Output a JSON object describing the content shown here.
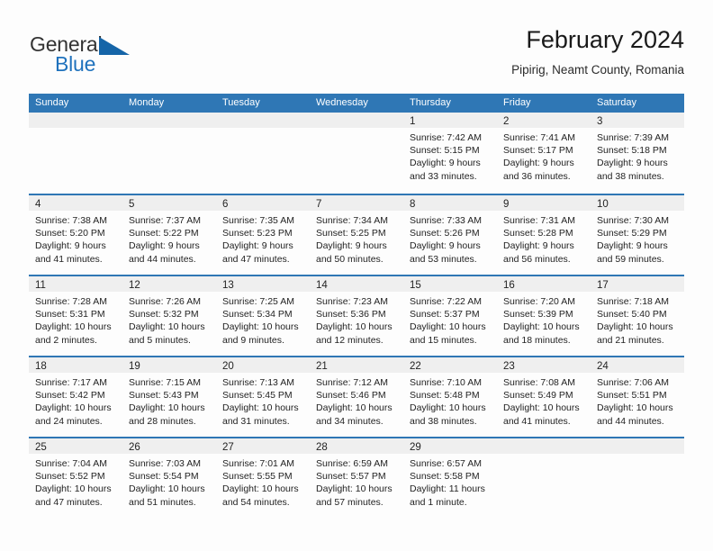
{
  "brand": {
    "word_one": "General",
    "word_two": "Blue",
    "icon": "triangle-logo",
    "accent_color": "#1f72bd"
  },
  "header": {
    "title": "February 2024",
    "subtitle": "Pipirig, Neamt County, Romania"
  },
  "theme": {
    "header_blue": "#2f77b5",
    "day_band_gray": "#efefef",
    "text": "#232323"
  },
  "weekdays": [
    "Sunday",
    "Monday",
    "Tuesday",
    "Wednesday",
    "Thursday",
    "Friday",
    "Saturday"
  ],
  "weeks": [
    [
      {
        "day": "",
        "lines": []
      },
      {
        "day": "",
        "lines": []
      },
      {
        "day": "",
        "lines": []
      },
      {
        "day": "",
        "lines": []
      },
      {
        "day": "1",
        "lines": [
          "Sunrise: 7:42 AM",
          "Sunset: 5:15 PM",
          "Daylight: 9 hours",
          "and 33 minutes."
        ]
      },
      {
        "day": "2",
        "lines": [
          "Sunrise: 7:41 AM",
          "Sunset: 5:17 PM",
          "Daylight: 9 hours",
          "and 36 minutes."
        ]
      },
      {
        "day": "3",
        "lines": [
          "Sunrise: 7:39 AM",
          "Sunset: 5:18 PM",
          "Daylight: 9 hours",
          "and 38 minutes."
        ]
      }
    ],
    [
      {
        "day": "4",
        "lines": [
          "Sunrise: 7:38 AM",
          "Sunset: 5:20 PM",
          "Daylight: 9 hours",
          "and 41 minutes."
        ]
      },
      {
        "day": "5",
        "lines": [
          "Sunrise: 7:37 AM",
          "Sunset: 5:22 PM",
          "Daylight: 9 hours",
          "and 44 minutes."
        ]
      },
      {
        "day": "6",
        "lines": [
          "Sunrise: 7:35 AM",
          "Sunset: 5:23 PM",
          "Daylight: 9 hours",
          "and 47 minutes."
        ]
      },
      {
        "day": "7",
        "lines": [
          "Sunrise: 7:34 AM",
          "Sunset: 5:25 PM",
          "Daylight: 9 hours",
          "and 50 minutes."
        ]
      },
      {
        "day": "8",
        "lines": [
          "Sunrise: 7:33 AM",
          "Sunset: 5:26 PM",
          "Daylight: 9 hours",
          "and 53 minutes."
        ]
      },
      {
        "day": "9",
        "lines": [
          "Sunrise: 7:31 AM",
          "Sunset: 5:28 PM",
          "Daylight: 9 hours",
          "and 56 minutes."
        ]
      },
      {
        "day": "10",
        "lines": [
          "Sunrise: 7:30 AM",
          "Sunset: 5:29 PM",
          "Daylight: 9 hours",
          "and 59 minutes."
        ]
      }
    ],
    [
      {
        "day": "11",
        "lines": [
          "Sunrise: 7:28 AM",
          "Sunset: 5:31 PM",
          "Daylight: 10 hours",
          "and 2 minutes."
        ]
      },
      {
        "day": "12",
        "lines": [
          "Sunrise: 7:26 AM",
          "Sunset: 5:32 PM",
          "Daylight: 10 hours",
          "and 5 minutes."
        ]
      },
      {
        "day": "13",
        "lines": [
          "Sunrise: 7:25 AM",
          "Sunset: 5:34 PM",
          "Daylight: 10 hours",
          "and 9 minutes."
        ]
      },
      {
        "day": "14",
        "lines": [
          "Sunrise: 7:23 AM",
          "Sunset: 5:36 PM",
          "Daylight: 10 hours",
          "and 12 minutes."
        ]
      },
      {
        "day": "15",
        "lines": [
          "Sunrise: 7:22 AM",
          "Sunset: 5:37 PM",
          "Daylight: 10 hours",
          "and 15 minutes."
        ]
      },
      {
        "day": "16",
        "lines": [
          "Sunrise: 7:20 AM",
          "Sunset: 5:39 PM",
          "Daylight: 10 hours",
          "and 18 minutes."
        ]
      },
      {
        "day": "17",
        "lines": [
          "Sunrise: 7:18 AM",
          "Sunset: 5:40 PM",
          "Daylight: 10 hours",
          "and 21 minutes."
        ]
      }
    ],
    [
      {
        "day": "18",
        "lines": [
          "Sunrise: 7:17 AM",
          "Sunset: 5:42 PM",
          "Daylight: 10 hours",
          "and 24 minutes."
        ]
      },
      {
        "day": "19",
        "lines": [
          "Sunrise: 7:15 AM",
          "Sunset: 5:43 PM",
          "Daylight: 10 hours",
          "and 28 minutes."
        ]
      },
      {
        "day": "20",
        "lines": [
          "Sunrise: 7:13 AM",
          "Sunset: 5:45 PM",
          "Daylight: 10 hours",
          "and 31 minutes."
        ]
      },
      {
        "day": "21",
        "lines": [
          "Sunrise: 7:12 AM",
          "Sunset: 5:46 PM",
          "Daylight: 10 hours",
          "and 34 minutes."
        ]
      },
      {
        "day": "22",
        "lines": [
          "Sunrise: 7:10 AM",
          "Sunset: 5:48 PM",
          "Daylight: 10 hours",
          "and 38 minutes."
        ]
      },
      {
        "day": "23",
        "lines": [
          "Sunrise: 7:08 AM",
          "Sunset: 5:49 PM",
          "Daylight: 10 hours",
          "and 41 minutes."
        ]
      },
      {
        "day": "24",
        "lines": [
          "Sunrise: 7:06 AM",
          "Sunset: 5:51 PM",
          "Daylight: 10 hours",
          "and 44 minutes."
        ]
      }
    ],
    [
      {
        "day": "25",
        "lines": [
          "Sunrise: 7:04 AM",
          "Sunset: 5:52 PM",
          "Daylight: 10 hours",
          "and 47 minutes."
        ]
      },
      {
        "day": "26",
        "lines": [
          "Sunrise: 7:03 AM",
          "Sunset: 5:54 PM",
          "Daylight: 10 hours",
          "and 51 minutes."
        ]
      },
      {
        "day": "27",
        "lines": [
          "Sunrise: 7:01 AM",
          "Sunset: 5:55 PM",
          "Daylight: 10 hours",
          "and 54 minutes."
        ]
      },
      {
        "day": "28",
        "lines": [
          "Sunrise: 6:59 AM",
          "Sunset: 5:57 PM",
          "Daylight: 10 hours",
          "and 57 minutes."
        ]
      },
      {
        "day": "29",
        "lines": [
          "Sunrise: 6:57 AM",
          "Sunset: 5:58 PM",
          "Daylight: 11 hours",
          "and 1 minute."
        ]
      },
      {
        "day": "",
        "lines": []
      },
      {
        "day": "",
        "lines": []
      }
    ]
  ]
}
